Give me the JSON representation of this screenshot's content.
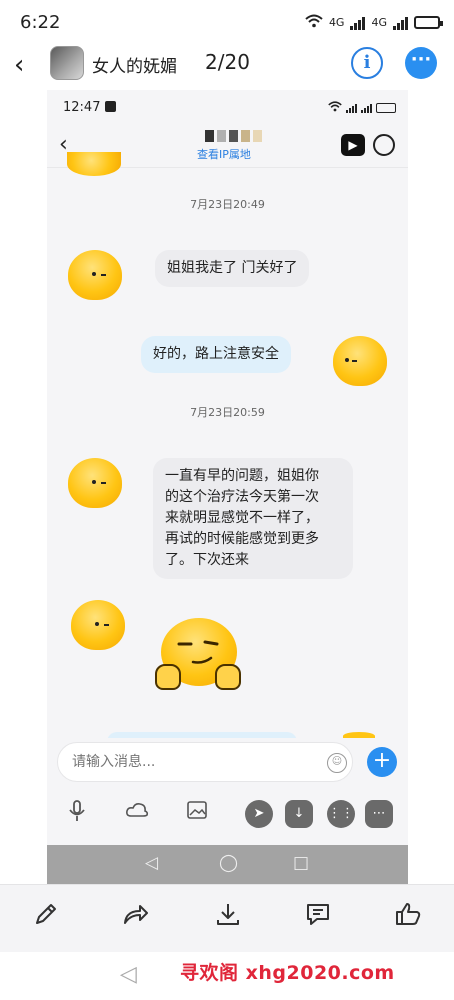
{
  "status_bar": {
    "time": "6:22",
    "net1": "4G",
    "net2": "4G"
  },
  "header": {
    "back_icon": "chevron-left-icon",
    "title": "女人的妩媚",
    "counter": "2/20",
    "info_icon": "info-icon",
    "more_icon": "more-dots-icon"
  },
  "inner": {
    "status_bar": {
      "time": "12:47"
    },
    "header": {
      "ip_link": "查看IP属地",
      "video_icon": "video-call-icon",
      "user_icon": "profile-icon"
    },
    "messages": [
      {
        "type": "timestamp",
        "text": "7月23日20:49"
      },
      {
        "type": "incoming",
        "text": "姐姐我走了 门关好了"
      },
      {
        "type": "outgoing",
        "text": "好的，路上注意安全"
      },
      {
        "type": "timestamp",
        "text": "7月23日20:59"
      },
      {
        "type": "incoming",
        "lines": [
          "一直有早的问题，姐姐你",
          "的这个治疗法今天第一次",
          "来就明显感觉不一样了，",
          "再试的时候能感觉到更多",
          "了。下次还来"
        ]
      },
      {
        "type": "incoming-sticker",
        "sticker": "thumbs-up-smirk-emoji"
      }
    ],
    "input": {
      "placeholder": "请输入消息..."
    },
    "toolbar": [
      "mic-icon",
      "cloud-icon",
      "image-icon",
      "share-icon",
      "download-icon",
      "apps-icon",
      "chat-icon"
    ]
  },
  "action_bar": [
    "edit-icon",
    "share-icon",
    "download-icon",
    "comment-icon",
    "like-icon"
  ],
  "watermark": "寻欢阁 xhg2020.com",
  "colors": {
    "accent": "#2a8ff0",
    "outgoing_bubble": "#dff0fb",
    "incoming_bubble": "#ececef",
    "watermark": "#e0263a"
  }
}
